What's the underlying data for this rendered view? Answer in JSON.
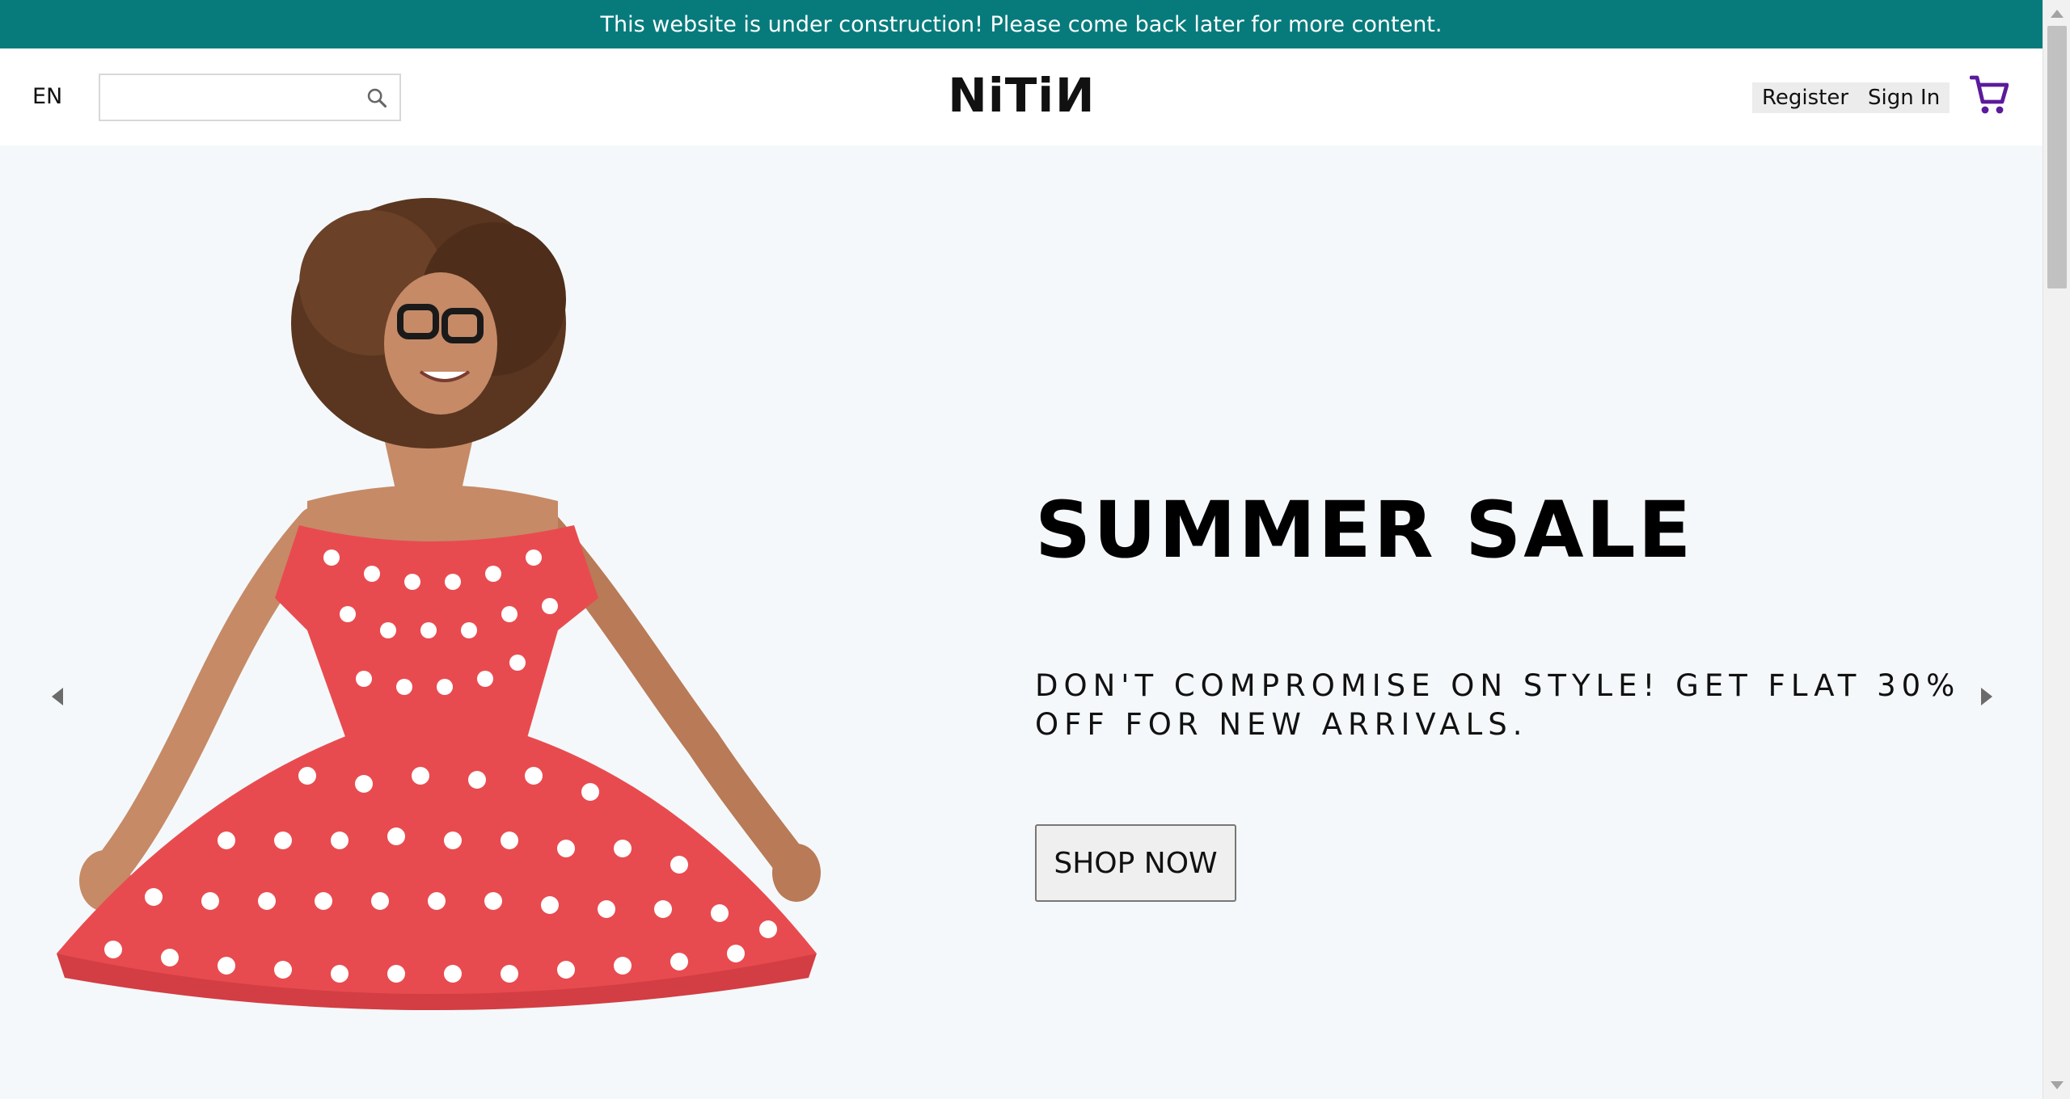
{
  "announcement": {
    "text": "This website is under construction! Please come back later for more content.",
    "background": "#077b7c"
  },
  "header": {
    "language": "EN",
    "search": {
      "value": "",
      "placeholder": "",
      "icon": "search-icon"
    },
    "logo": {
      "left": "NiT",
      "flipped_i": "i",
      "flipped_n": "N"
    },
    "auth": {
      "register": "Register",
      "sign_in": "Sign In"
    },
    "cart_icon": "shopping-cart-icon",
    "cart_color": "#5b1a9b"
  },
  "hero": {
    "title": "SUMMER SALE",
    "description": "DON'T COMPROMISE ON STYLE! GET FLAT 30% OFF FOR NEW ARRIVALS.",
    "button": "SHOP NOW",
    "background": "#f4f8fa",
    "prev_icon": "caret-left-icon",
    "next_icon": "caret-right-icon",
    "image": "woman-in-red-polka-dot-dress"
  }
}
